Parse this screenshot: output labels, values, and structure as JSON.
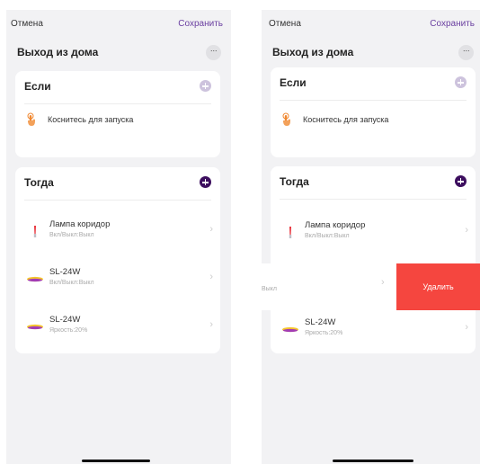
{
  "left": {
    "cancel": "Отмена",
    "save": "Сохранить",
    "scene_title": "Выход из дома",
    "more": "···",
    "if_card": {
      "title": "Если",
      "trigger": "Коснитесь для запуска"
    },
    "then_card": {
      "title": "Тогда",
      "actions": [
        {
          "name": "Лампа коридор",
          "state": "Вкл/Выкл:Выкл",
          "icon": "bulb-icon"
        },
        {
          "name": "SL-24W",
          "state": "Вкл/Выкл:Выкл",
          "icon": "lamp-disc-icon"
        },
        {
          "name": "SL-24W",
          "state": "Яркость:20%",
          "icon": "lamp-disc-icon"
        }
      ]
    }
  },
  "right": {
    "cancel": "Отмена",
    "save": "Сохранить",
    "scene_title": "Выход из дома",
    "more": "···",
    "if_card": {
      "title": "Если",
      "trigger": "Коснитесь для запуска"
    },
    "then_card": {
      "title": "Тогда",
      "actions": [
        {
          "name": "Лампа коридор",
          "state": "Вкл/Выкл:Выкл",
          "icon": "bulb-icon"
        },
        {
          "name": "SL-24W",
          "state": "Яркость:20%",
          "icon": "lamp-disc-icon"
        }
      ]
    },
    "swipe_row": {
      "partial_state": "Выкл",
      "delete": "Удалить"
    }
  },
  "colors": {
    "accent": "#6a3fa0",
    "dark_plus": "#3d0f5f",
    "delete": "#f5463f",
    "background": "#f2f2f4"
  }
}
